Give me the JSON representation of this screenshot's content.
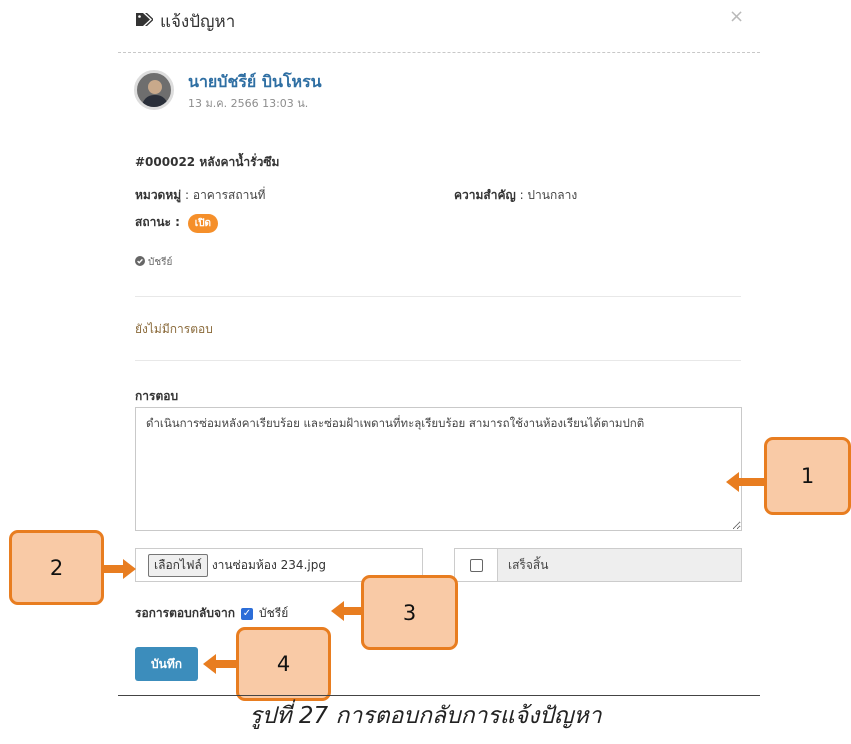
{
  "modal": {
    "title": "แจ้งปัญหา",
    "close": "×"
  },
  "post": {
    "author": "นายบัชรีย์ บินโหรน",
    "timestamp": "13 ม.ค. 2566 13:03 น.",
    "issue": "#000022 หลังคาน้ำรั่วซึม",
    "category_label": "หมวดหมู่",
    "category_value": ": อาคารสถานที่",
    "priority_label": "ความสำคัญ",
    "priority_value": ": ปานกลาง",
    "status_label": "สถานะ :",
    "status_value": "เปิด",
    "reviewer": "บัชรีย์"
  },
  "replies": {
    "empty_text": "ยังไม่มีการตอบ"
  },
  "form": {
    "reply_label": "การตอบ",
    "reply_value": "ดำเนินการซ่อมหลังคาเรียบร้อย และซ่อมฝ้าเพดานที่ทะลุเรียบร้อย สามารถใช้งานห้องเรียนได้ตามปกติ",
    "file_button": "เลือกไฟล์",
    "file_name": "งานซ่อมห้อง 234.jpg",
    "done_label": "เสร็จสิ้น",
    "done_checked": false,
    "await_label": "รอการตอบกลับจาก",
    "await_user": "บัชรีย์",
    "await_checked": true,
    "save_button": "บันทึก"
  },
  "callouts": [
    "1",
    "2",
    "3",
    "4"
  ],
  "caption": "รูปที่ 27 การตอบกลับการแจ้งปัญหา",
  "colors": {
    "primary": "#3c8dbc",
    "badge": "#f58f2a",
    "callout_fill": "#f9caa6",
    "callout_border": "#e87d20",
    "author_link": "#2f6fa3"
  }
}
